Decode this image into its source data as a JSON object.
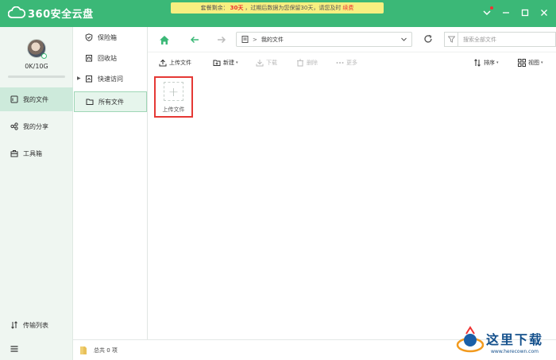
{
  "app": {
    "title": "360安全云盘",
    "notice_prefix": "套餐剩余：",
    "notice_days": "30天",
    "notice_suffix": "，过期后数据为您保留30天，请您及时",
    "notice_action": "续费"
  },
  "sidebar": {
    "quota": "0K/10G",
    "quota_fraction": 0,
    "items": [
      {
        "label": "我的文件",
        "icon": "my-files-icon"
      },
      {
        "label": "我的分享",
        "icon": "share-icon"
      },
      {
        "label": "工具箱",
        "icon": "toolbox-icon"
      }
    ],
    "transfer_label": "传输列表"
  },
  "folders": {
    "items": [
      {
        "label": "保险箱",
        "icon": "shield-icon"
      },
      {
        "label": "回收站",
        "icon": "recycle-bin-icon"
      },
      {
        "label": "快速访问",
        "icon": "quick-access-icon"
      },
      {
        "label": "所有文件",
        "icon": "folder-icon"
      }
    ]
  },
  "nav": {
    "path": "我的文件",
    "search_placeholder": "搜索全部文件"
  },
  "toolbar": {
    "upload": "上传文件",
    "new": "新建",
    "download": "下载",
    "delete": "删除",
    "more": "更多",
    "sort": "排序",
    "view": "视图"
  },
  "content": {
    "upload_tile_label": "上传文件"
  },
  "status": {
    "total": "总共 0 项"
  },
  "watermark": {
    "text": "这里下载",
    "url": "www.herecown.com"
  },
  "colors": {
    "brand": "#3bb877",
    "sidebar_bg": "#eff6f1",
    "active_bg": "#cdeadb",
    "highlight_red": "#e53935"
  }
}
